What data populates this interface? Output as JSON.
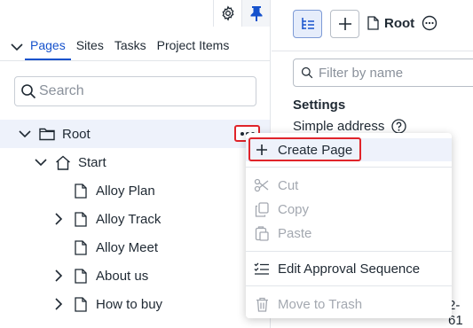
{
  "toolbar": {
    "settings_icon": "gear-icon",
    "pin_icon": "pin-icon",
    "accent": "#1652cc"
  },
  "tabs": [
    {
      "label": "Pages",
      "active": true
    },
    {
      "label": "Sites",
      "active": false
    },
    {
      "label": "Tasks",
      "active": false
    },
    {
      "label": "Project Items",
      "active": false
    }
  ],
  "search": {
    "placeholder": "Search",
    "value": ""
  },
  "tree": {
    "root": {
      "label": "Root",
      "expanded": true,
      "selected": true
    },
    "start": {
      "label": "Start",
      "expanded": true
    },
    "items": [
      {
        "label": "Alloy Plan",
        "has_children": false
      },
      {
        "label": "Alloy Track",
        "has_children": true
      },
      {
        "label": "Alloy Meet",
        "has_children": false
      },
      {
        "label": "About us",
        "has_children": true
      },
      {
        "label": "How to buy",
        "has_children": true
      }
    ]
  },
  "context_menu": {
    "items": {
      "create_page": {
        "label": "Create Page",
        "enabled": true,
        "icon": "plus-icon"
      },
      "cut": {
        "label": "Cut",
        "enabled": false,
        "icon": "scissors-icon"
      },
      "copy": {
        "label": "Copy",
        "enabled": false,
        "icon": "copy-icon"
      },
      "paste": {
        "label": "Paste",
        "enabled": false,
        "icon": "paste-icon"
      },
      "edit_approval": {
        "label": "Edit Approval Sequence",
        "enabled": true,
        "icon": "list-check-icon"
      },
      "move_trash": {
        "label": "Move to Trash",
        "enabled": false,
        "icon": "trash-icon"
      }
    }
  },
  "right_panel": {
    "title": "Root",
    "filter_placeholder": "Filter by name",
    "settings_heading": "Settings",
    "simple_address_label": "Simple address",
    "cut_text": "2-61"
  },
  "colors": {
    "highlight_outline": "#e0242a",
    "selected_row": "#eef2fb",
    "disabled_text": "#a3a8b0"
  }
}
